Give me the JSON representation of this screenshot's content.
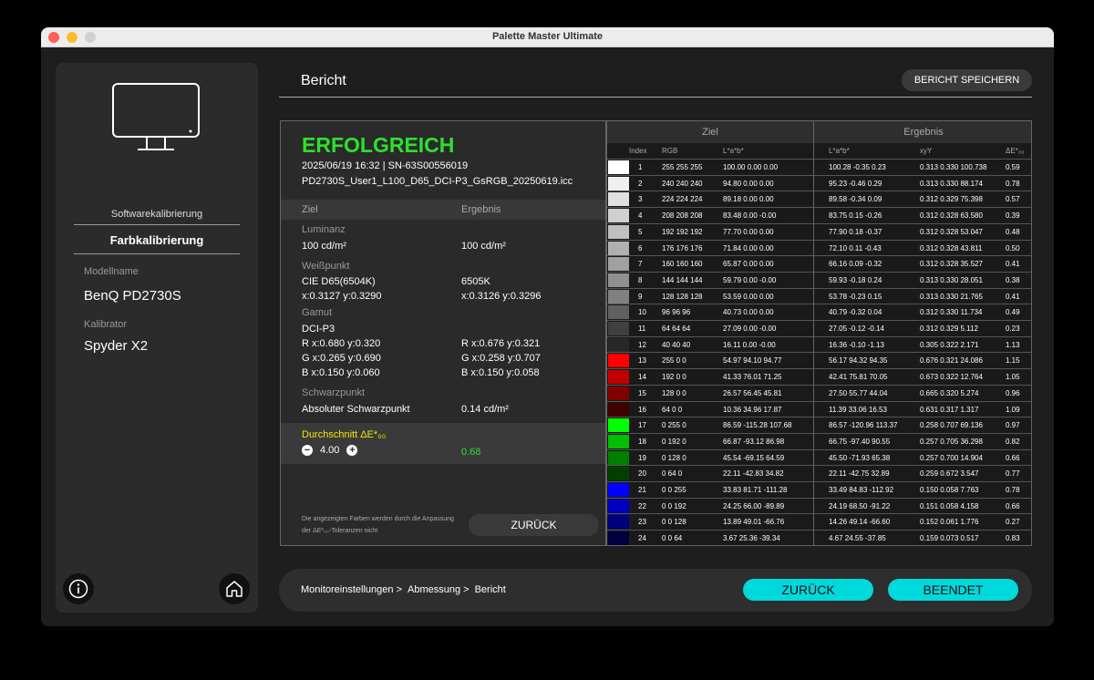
{
  "app_title": "Palette Master Ultimate",
  "sidebar": {
    "item_software": "Softwarekalibrierung",
    "item_color": "Farbkalibrierung",
    "model_label": "Modellname",
    "model_value": "BenQ PD2730S",
    "calibrator_label": "Kalibrator",
    "calibrator_value": "Spyder X2"
  },
  "header": {
    "title": "Bericht",
    "save_label": "BERICHT SPEICHERN"
  },
  "report": {
    "status": "ERFOLGREICH",
    "date_sn": "2025/06/19 16:32 | SN-63S00556019",
    "filename": "PD2730S_User1_L100_D65_DCI-P3_GsRGB_20250619.icc",
    "col_target": "Ziel",
    "col_result": "Ergebnis",
    "luminance_label": "Luminanz",
    "luminance_target": "100 cd/m²",
    "luminance_result": "100 cd/m²",
    "whitepoint_label": "Weißpunkt",
    "wp_target_1": "CIE D65(6504K)",
    "wp_target_2": "x:0.3127 y:0.3290",
    "wp_result_1": "6505K",
    "wp_result_2": "x:0.3126 y:0.3296",
    "gamut_label": "Gamut",
    "gamut_name": "DCI-P3",
    "gamut_r_target": "R x:0.680 y:0.320",
    "gamut_g_target": "G x:0.265 y:0.690",
    "gamut_b_target": "B x:0.150 y:0.060",
    "gamut_r_result": "R x:0.676 y:0.321",
    "gamut_g_result": "G x:0.258 y:0.707",
    "gamut_b_result": "B x:0.150 y:0.058",
    "blackpoint_label": "Schwarzpunkt",
    "blackpoint_target": "Absoluter Schwarzpunkt",
    "blackpoint_result": "0.14 cd/m²",
    "avg_label": "Durchschnitt ΔE*₀₀",
    "tolerance": "4.00",
    "avg_value": "0.68",
    "note": "Die angezeigten Farben werden durch die Anpassung der  ΔE*₀₀-Toleranzen nicht",
    "back_small": "ZURÜCK"
  },
  "table": {
    "group_target": "Ziel",
    "group_result": "Ergebnis",
    "headers": {
      "index": "Index",
      "rgb": "RGB",
      "lab_t": "L*a*b*",
      "lab_r": "L*a*b*",
      "xyy": "xyY",
      "de": "ΔE*₀₀"
    },
    "rows": [
      {
        "i": "1",
        "rgb": "255 255 255",
        "lab": "100.00 0.00 0.00",
        "labr": "100.28 -0.35 0.23",
        "xyy": "0.313 0.330 100.738",
        "de": "0.59",
        "c": "#ffffff"
      },
      {
        "i": "2",
        "rgb": "240 240 240",
        "lab": "94.80 0.00 0.00",
        "labr": "95.23 -0.46 0.29",
        "xyy": "0.313 0.330 88.174",
        "de": "0.78",
        "c": "#f0f0f0"
      },
      {
        "i": "3",
        "rgb": "224 224 224",
        "lab": "89.18 0.00 0.00",
        "labr": "89.58 -0.34 0.09",
        "xyy": "0.312 0.329 75.398",
        "de": "0.57",
        "c": "#e0e0e0"
      },
      {
        "i": "4",
        "rgb": "208 208 208",
        "lab": "83.48 0.00 -0.00",
        "labr": "83.75 0.15 -0.26",
        "xyy": "0.312 0.328 63.580",
        "de": "0.39",
        "c": "#d0d0d0"
      },
      {
        "i": "5",
        "rgb": "192 192 192",
        "lab": "77.70 0.00 0.00",
        "labr": "77.90 0.18 -0.37",
        "xyy": "0.312 0.328 53.047",
        "de": "0.48",
        "c": "#c0c0c0"
      },
      {
        "i": "6",
        "rgb": "176 176 176",
        "lab": "71.84 0.00 0.00",
        "labr": "72.10 0.11 -0.43",
        "xyy": "0.312 0.328 43.811",
        "de": "0.50",
        "c": "#b0b0b0"
      },
      {
        "i": "7",
        "rgb": "160 160 160",
        "lab": "65.87 0.00 0.00",
        "labr": "66.16 0.09 -0.32",
        "xyy": "0.312 0.328 35.527",
        "de": "0.41",
        "c": "#a0a0a0"
      },
      {
        "i": "8",
        "rgb": "144 144 144",
        "lab": "59.79 0.00 -0.00",
        "labr": "59.93 -0.18 0.24",
        "xyy": "0.313 0.330 28.051",
        "de": "0.38",
        "c": "#909090"
      },
      {
        "i": "9",
        "rgb": "128 128 128",
        "lab": "53.59 0.00 0.00",
        "labr": "53.78 -0.23 0.15",
        "xyy": "0.313 0.330 21.765",
        "de": "0.41",
        "c": "#808080"
      },
      {
        "i": "10",
        "rgb": "96 96 96",
        "lab": "40.73 0.00 0.00",
        "labr": "40.79 -0.32 0.04",
        "xyy": "0.312 0.330 11.734",
        "de": "0.49",
        "c": "#606060"
      },
      {
        "i": "11",
        "rgb": "64 64 64",
        "lab": "27.09 0.00 -0.00",
        "labr": "27.05 -0.12 -0.14",
        "xyy": "0.312 0.329 5.112",
        "de": "0.23",
        "c": "#404040"
      },
      {
        "i": "12",
        "rgb": "40 40 40",
        "lab": "16.11 0.00 -0.00",
        "labr": "16.36 -0.10 -1.13",
        "xyy": "0.305 0.322 2.171",
        "de": "1.13",
        "c": "#282828"
      },
      {
        "i": "13",
        "rgb": "255 0 0",
        "lab": "54.97 94.10 94.77",
        "labr": "56.17 94.32 94.35",
        "xyy": "0.676 0.321 24.086",
        "de": "1.15",
        "c": "#ff0000"
      },
      {
        "i": "14",
        "rgb": "192 0 0",
        "lab": "41.33 76.01 71.25",
        "labr": "42.41 75.81 70.05",
        "xyy": "0.673 0.322 12.764",
        "de": "1.05",
        "c": "#c00000"
      },
      {
        "i": "15",
        "rgb": "128 0 0",
        "lab": "26.57 56.45 45.81",
        "labr": "27.50 55.77 44.04",
        "xyy": "0.665 0.320 5.274",
        "de": "0.96",
        "c": "#800000"
      },
      {
        "i": "16",
        "rgb": "64 0 0",
        "lab": "10.36 34.96 17.87",
        "labr": "11.39 33.06 16.53",
        "xyy": "0.631 0.317 1.317",
        "de": "1.09",
        "c": "#400000"
      },
      {
        "i": "17",
        "rgb": "0 255 0",
        "lab": "86.59 -115.28 107.68",
        "labr": "86.57 -120.96 113.37",
        "xyy": "0.258 0.707 69.136",
        "de": "0.97",
        "c": "#00ff00"
      },
      {
        "i": "18",
        "rgb": "0 192 0",
        "lab": "66.87 -93.12 86.98",
        "labr": "66.75 -97.40 90.55",
        "xyy": "0.257 0.705 36.298",
        "de": "0.82",
        "c": "#00c000"
      },
      {
        "i": "19",
        "rgb": "0 128 0",
        "lab": "45.54 -69.15 64.59",
        "labr": "45.50 -71.93 65.38",
        "xyy": "0.257 0.700 14.904",
        "de": "0.66",
        "c": "#008000"
      },
      {
        "i": "20",
        "rgb": "0 64 0",
        "lab": "22.11 -42.83 34.82",
        "labr": "22.11 -42.75 32.89",
        "xyy": "0.259 0.672 3.547",
        "de": "0.77",
        "c": "#004000"
      },
      {
        "i": "21",
        "rgb": "0 0 255",
        "lab": "33.83 81.71 -111.28",
        "labr": "33.49 84.83 -112.92",
        "xyy": "0.150 0.058 7.763",
        "de": "0.78",
        "c": "#0000ff"
      },
      {
        "i": "22",
        "rgb": "0 0 192",
        "lab": "24.25 66.00 -89.89",
        "labr": "24.19 68.50 -91.22",
        "xyy": "0.151 0.058 4.158",
        "de": "0.66",
        "c": "#0000c0"
      },
      {
        "i": "23",
        "rgb": "0 0 128",
        "lab": "13.89 49.01 -66.76",
        "labr": "14.26 49.14 -66.60",
        "xyy": "0.152 0.061 1.776",
        "de": "0.27",
        "c": "#000080"
      },
      {
        "i": "24",
        "rgb": "0 0 64",
        "lab": "3.67 25.36 -39.34",
        "labr": "4.67 24.55 -37.85",
        "xyy": "0.159 0.073 0.517",
        "de": "0.83",
        "c": "#000040"
      }
    ]
  },
  "footer": {
    "crumb_1": "Monitoreinstellungen >",
    "crumb_2": "Abmessung >",
    "crumb_3": "Bericht",
    "back": "ZURÜCK",
    "finish": "BEENDET"
  },
  "colors": {
    "accent": "#00d9dc",
    "success": "#2de02d",
    "highlight": "#f2e600"
  }
}
